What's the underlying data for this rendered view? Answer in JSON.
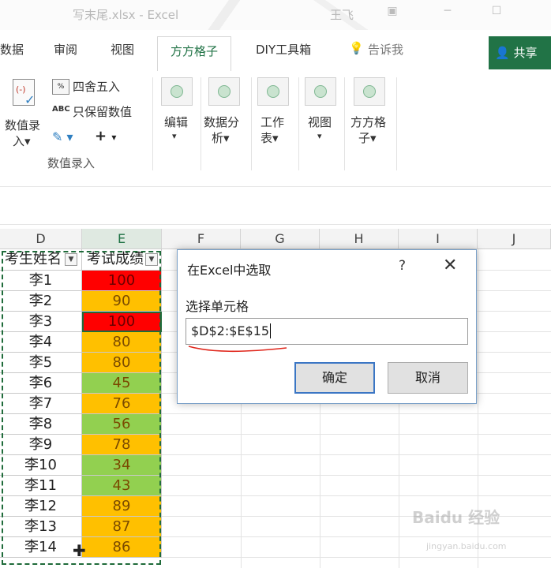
{
  "window": {
    "doc_title": "写末尾.xlsx - Excel",
    "user": "王飞"
  },
  "tabs": [
    "数据",
    "审阅",
    "视图",
    "方方格子",
    "DIY工具箱"
  ],
  "active_tab": "方方格子",
  "tell_me": "告诉我",
  "share": "共享",
  "ribbon": {
    "data_entry": [
      "数值录",
      "入▾"
    ],
    "round": "四舍五入",
    "keep_values": "只保留数值",
    "group_label": "数值录入",
    "groups": [
      {
        "l1": "编辑",
        "l2": "▾"
      },
      {
        "l1": "数据分",
        "l2": "析▾"
      },
      {
        "l1": "工作",
        "l2": "表▾"
      },
      {
        "l1": "视图",
        "l2": "▾"
      },
      {
        "l1": "方方格",
        "l2": "子▾"
      }
    ]
  },
  "columns": [
    "D",
    "E",
    "F",
    "G",
    "H",
    "I",
    "J"
  ],
  "table": {
    "headers": [
      "考生姓名",
      "考试成绩"
    ],
    "rows": [
      {
        "name": "李1",
        "score": "100"
      },
      {
        "name": "李2",
        "score": "90"
      },
      {
        "name": "李3",
        "score": "100"
      },
      {
        "name": "李4",
        "score": "80"
      },
      {
        "name": "李5",
        "score": "80"
      },
      {
        "name": "李6",
        "score": "45"
      },
      {
        "name": "李7",
        "score": "76"
      },
      {
        "name": "李8",
        "score": "56"
      },
      {
        "name": "李9",
        "score": "78"
      },
      {
        "name": "李10",
        "score": "34"
      },
      {
        "name": "李11",
        "score": "43"
      },
      {
        "name": "李12",
        "score": "89"
      },
      {
        "name": "李13",
        "score": "87"
      },
      {
        "name": "李14",
        "score": "86"
      }
    ]
  },
  "colors": {
    "red": "#ff0000",
    "orange": "#ffc000",
    "green": "#92d050",
    "excel_green": "#217346"
  },
  "dialog": {
    "title": "在Excel中选取",
    "help": "?",
    "close": "✕",
    "label": "选择单元格",
    "value": "$D$2:$E$15",
    "ok": "确定",
    "cancel": "取消"
  },
  "watermark": {
    "brand": "Baidu 经验",
    "url": "jingyan.baidu.com"
  }
}
